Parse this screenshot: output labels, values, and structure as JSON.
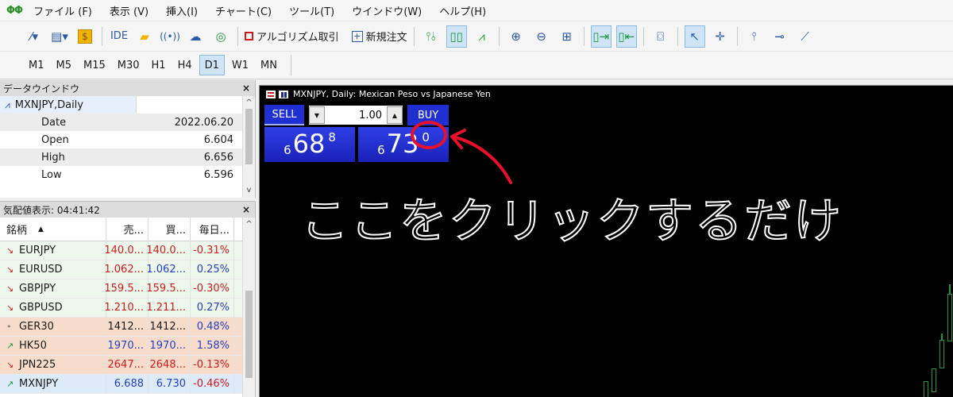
{
  "menu": {
    "app_icon": "ΦΦ",
    "items": [
      "ファイル (F)",
      "表示 (V)",
      "挿入(I)",
      "チャート(C)",
      "ツール(T)",
      "ウインドウ(W)",
      "ヘルプ(H)"
    ]
  },
  "toolbar": {
    "ide_label": "IDE",
    "algo_label": "アルゴリズム取引",
    "new_order_label": "新規注文",
    "dollar_label": "$"
  },
  "periods": [
    "M1",
    "M5",
    "M15",
    "M30",
    "H1",
    "H4",
    "D1",
    "W1",
    "MN"
  ],
  "active_period": "D1",
  "data_window": {
    "title": "データウインドウ",
    "close": "×",
    "symbol": "MXNJPY,Daily",
    "rows": [
      {
        "label": "Date",
        "value": "2022.06.20"
      },
      {
        "label": "Open",
        "value": "6.604"
      },
      {
        "label": "High",
        "value": "6.656"
      },
      {
        "label": "Low",
        "value": "6.596"
      }
    ]
  },
  "quotes": {
    "title": "気配値表示: 04:41:42",
    "close": "×",
    "headers": {
      "symbol": "銘柄",
      "bid": "売...",
      "ask": "買...",
      "change": "毎日..."
    },
    "sort_arrow": "▲",
    "rows": [
      {
        "arrow": "↘",
        "symbol": "EURJPY",
        "bid": "140.0...",
        "ask": "140.0...",
        "change": "-0.31%"
      },
      {
        "arrow": "↘",
        "symbol": "EURUSD",
        "bid": "1.062...",
        "ask": "1.062...",
        "change": "0.25%"
      },
      {
        "arrow": "↘",
        "symbol": "GBPJPY",
        "bid": "159.5...",
        "ask": "159.5...",
        "change": "-0.30%"
      },
      {
        "arrow": "↘",
        "symbol": "GBPUSD",
        "bid": "1.210...",
        "ask": "1.211...",
        "change": "0.27%"
      },
      {
        "arrow": "•",
        "symbol": "GER30",
        "bid": "1412...",
        "ask": "1412...",
        "change": "0.48%"
      },
      {
        "arrow": "↗",
        "symbol": "HK50",
        "bid": "1970...",
        "ask": "1970...",
        "change": "1.58%"
      },
      {
        "arrow": "↘",
        "symbol": "JPN225",
        "bid": "2647...",
        "ask": "2648...",
        "change": "-0.13%"
      },
      {
        "arrow": "↗",
        "symbol": "MXNJPY",
        "bid": "6.688",
        "ask": "6.730",
        "change": "-0.46%"
      }
    ]
  },
  "chart": {
    "title": "MXNJPY, Daily:  Mexican Peso vs Japanese Yen",
    "sell_label": "SELL",
    "buy_label": "BUY",
    "volume": "1.00",
    "sell_price": {
      "prefix": "6",
      "big": "68",
      "sup": "8"
    },
    "buy_price": {
      "prefix": "6",
      "big": "73",
      "sup": "0"
    },
    "annotation": "ここをクリックするだけ"
  },
  "colors": {
    "trade_blue": "#1f2fd1",
    "highlight_red": "#e8102a",
    "candle_green": "#1c9a3c"
  }
}
